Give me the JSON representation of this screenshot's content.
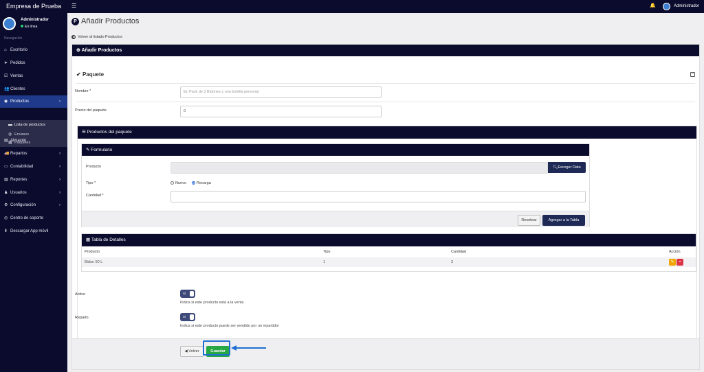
{
  "topbar": {
    "brand": "Empresa de Prueba",
    "hamburger_icon": "☰",
    "bell_icon": "🔔",
    "user": "Administrador"
  },
  "sidebar": {
    "user_name": "Administrador",
    "user_status": "En línea",
    "nav_header": "Navegación",
    "items": [
      {
        "icon": "⌂",
        "label": "Escritorio"
      },
      {
        "icon": "➤",
        "label": "Pedidos"
      },
      {
        "icon": "☑",
        "label": "Ventas"
      },
      {
        "icon": "👥",
        "label": "Clientes"
      },
      {
        "icon": "◉",
        "label": "Productos"
      },
      {
        "icon": "▤",
        "label": "Almacén"
      },
      {
        "icon": "🚚",
        "label": "Repartos"
      },
      {
        "icon": "▭",
        "label": "Contabilidad"
      },
      {
        "icon": "▥",
        "label": "Reportes"
      },
      {
        "icon": "♟",
        "label": "Usuarios"
      },
      {
        "icon": "⚙",
        "label": "Configuración"
      },
      {
        "icon": "◎",
        "label": "Centro de soporte"
      },
      {
        "icon": "⬇",
        "label": "Descargar App móvil"
      }
    ],
    "subitems": [
      {
        "icon": "▬",
        "label": "Lista de productos"
      },
      {
        "icon": "◍",
        "label": "Envases"
      },
      {
        "icon": "▦",
        "label": "Paquetes"
      }
    ]
  },
  "page": {
    "title": "Añadir Productos",
    "back_link": "Volver al listado Productos",
    "card_title": "Añadir Productos",
    "section_title": "Paquete",
    "nombre_label": "Nombre *",
    "nombre_placeholder": "Ej: Pack de 3 Bidones y una botella personal",
    "precio_label": "Precio del paquete",
    "precio_value": "0",
    "productos_header": "Productos del paquete",
    "form_header": "Formulario",
    "producto_label": "Producto",
    "escoger_button": "Escoger Dato",
    "tipo_label": "Tipo *",
    "tipo_options": [
      "Nuevo",
      "Recarga"
    ],
    "tipo_selected": "Recarga",
    "cantidad_label": "Cantidad *",
    "resetear_button": "Resetear",
    "agregar_button": "Agregar a la Tabla",
    "table_header": "Tabla de Detalles",
    "columns": [
      "Producto",
      "Tipo",
      "Cantidad",
      "Acción"
    ],
    "rows": [
      {
        "producto": "Bidon 50 L",
        "tipo": "1",
        "cantidad": "3"
      }
    ],
    "activo_label": "Activo",
    "activo_toggle": "Sí",
    "activo_help": "Indica si este producto está a la venta",
    "reparto_label": "Reparto",
    "reparto_toggle": "Sí",
    "reparto_help": "Indica si este producto puede ser vendido por un repartidor",
    "volver_button": "Volver",
    "guardar_button": "Guardar"
  }
}
